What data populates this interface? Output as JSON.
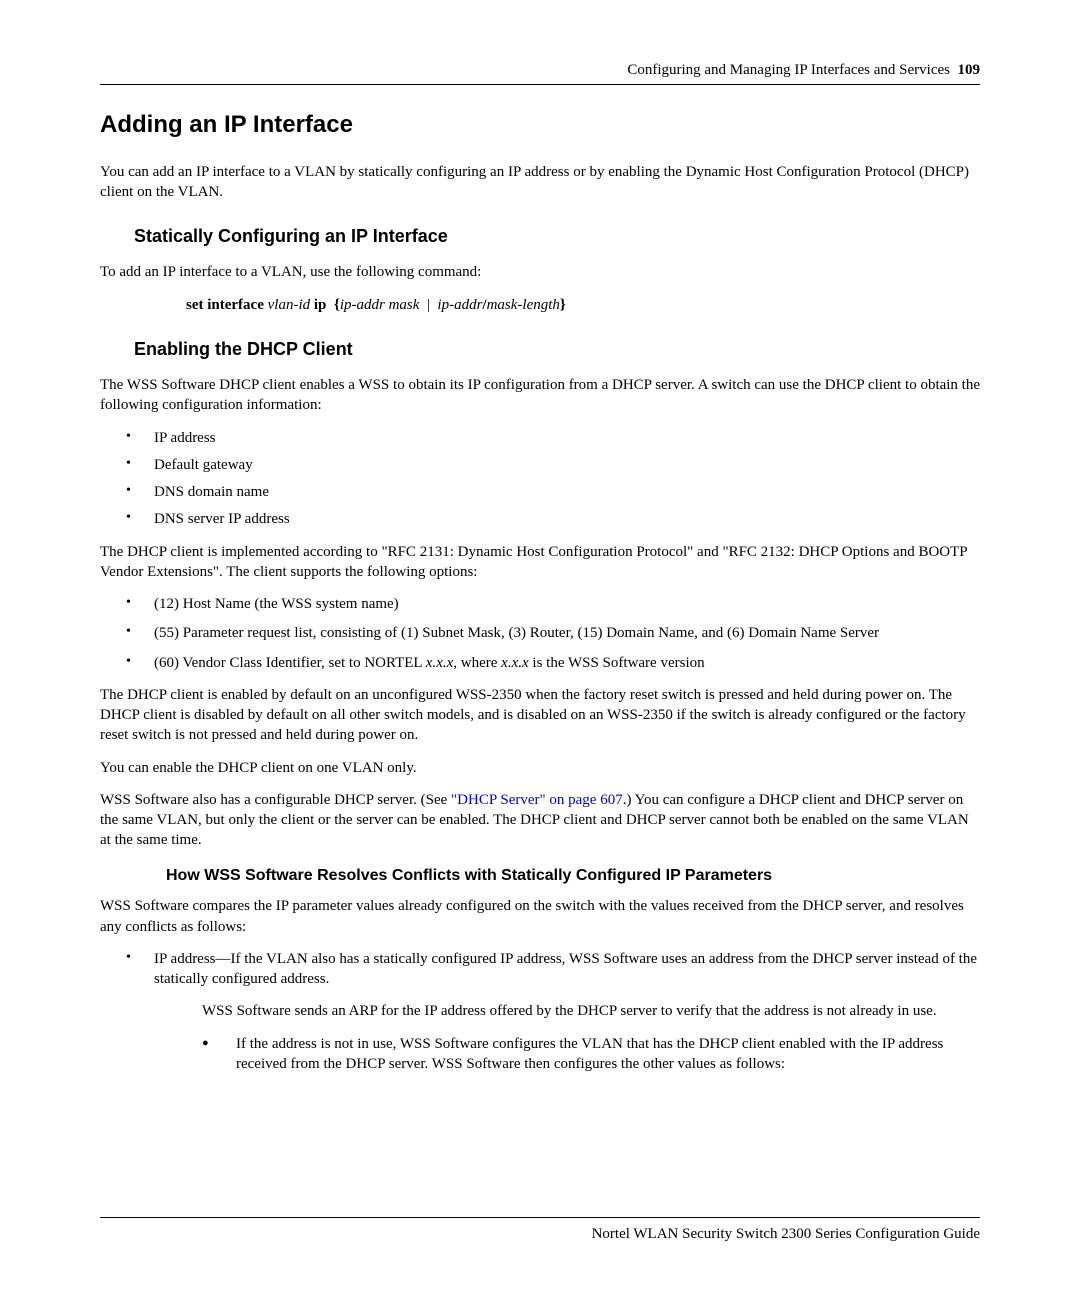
{
  "header": {
    "text": "Configuring and Managing IP Interfaces and Services",
    "page": "109"
  },
  "h1": "Adding an IP Interface",
  "intro": "You can add an IP interface to a VLAN by statically configuring an IP address or by enabling the Dynamic Host Configuration Protocol (DHCP) client on the VLAN.",
  "static": {
    "heading": "Statically Configuring an IP Interface",
    "p1": "To add an IP interface to a VLAN, use the following command:",
    "cmd": {
      "set_interface": "set interface",
      "vlan_id": "vlan-id",
      "ip": "ip",
      "lb": "{",
      "ip_addr_mask": "ip-addr mask",
      "pipe": "|",
      "ip_addr": "ip-addr",
      "slash": "/",
      "mask_length": "mask-length",
      "rb": "}"
    }
  },
  "dhcp": {
    "heading": "Enabling the DHCP Client",
    "p1": "The WSS Software DHCP client enables a WSS to obtain its IP configuration from a DHCP server. A switch can use the DHCP client to obtain the following configuration information:",
    "info": [
      "IP address",
      "Default gateway",
      "DNS domain name",
      "DNS server IP address"
    ],
    "p2": "The DHCP client is implemented according to \"RFC 2131: Dynamic Host Configuration Protocol\" and \"RFC 2132: DHCP Options and BOOTP Vendor Extensions\". The client supports the following options:",
    "options": [
      "(12) Host Name (the WSS system name)",
      "(55) Parameter request list, consisting of (1) Subnet Mask, (3) Router, (15) Domain Name, and (6) Domain Name Server",
      ""
    ],
    "opt3_pre": "(60) Vendor Class Identifier, set to NORTEL ",
    "opt3_xxx": "x.x.x",
    "opt3_mid": ", where ",
    "opt3_xxx2": "x.x.x",
    "opt3_post": " is the WSS Software version",
    "p3": "The DHCP client is enabled by default on an unconfigured WSS-2350 when the factory reset switch is pressed and held during power on. The DHCP client is disabled by default on all other switch models, and is disabled on an WSS-2350 if the switch is already configured or the factory reset switch is not pressed and held during power on.",
    "p4": "You can enable the DHCP client on one VLAN only.",
    "p5_pre": "WSS Software also has a configurable DHCP server. (See ",
    "p5_link": "\"DHCP Server\" on page 607",
    "p5_post": ".) You can configure a DHCP client and DHCP server on the same VLAN, but only the client or the server can be enabled. The DHCP client and DHCP server cannot both be enabled on the same VLAN at the same time."
  },
  "resolve": {
    "heading": "How WSS Software Resolves Conflicts with Statically Configured IP Parameters",
    "p1": "WSS Software compares the IP parameter values already configured on the switch with the values received from the DHCP server, and resolves any conflicts as follows:",
    "bullet1": "IP address—If the VLAN also has a statically configured IP address, WSS Software uses an address from the DHCP server instead of the statically configured address.",
    "sub_p": "WSS Software sends an ARP for the IP address offered by the DHCP server to verify that the address is not already in use.",
    "sub_bullet": "If the address is not in use, WSS Software configures the VLAN that has the DHCP client enabled with the IP address received from the DHCP server. WSS Software then configures the other values as follows:"
  },
  "footer": "Nortel WLAN Security Switch 2300 Series Configuration Guide"
}
